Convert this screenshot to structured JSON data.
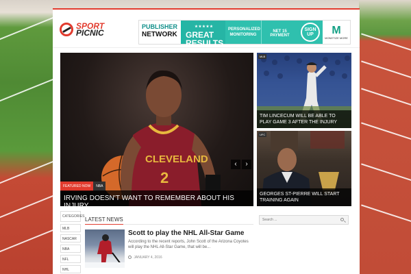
{
  "header": {
    "logo_line1": "SPORT",
    "logo_line2": "PICNIC"
  },
  "banner": {
    "publisher": "PUBLISHER",
    "network": "NETWORK",
    "great": "GREAT",
    "results": "RESULTS",
    "stars": "★★★★★",
    "personalized": "PERSONALIZED MONITORING",
    "payment": "NET 15 PAYMENT",
    "sign": "SIGN UP",
    "brand_mark": "M",
    "brand_name": "MONETIZE MORE"
  },
  "featured": {
    "tag_featured": "FEATURED NOW",
    "tag_league": "NBA",
    "title": "IRVING DOESN'T WANT TO REMEMBER ABOUT HIS INJURY",
    "jersey_text": "CLEVELAND",
    "jersey_number": "2",
    "prev_label": "‹",
    "next_label": "›"
  },
  "side_cards": [
    {
      "category": "MLB",
      "caption": "TIM LINCECUM WILL BE ABLE TO PLAY GAME 3 AFTER THE INJURY"
    },
    {
      "category": "UFC",
      "caption": "GEORGES ST-PIERRE WILL START TRAINING AGAIN"
    }
  ],
  "categories": {
    "title": "CATEGORIES",
    "items": [
      "MLB",
      "NASCAR",
      "NBA",
      "NFL",
      "NHL"
    ]
  },
  "latest": {
    "heading": "LATEST NEWS",
    "article": {
      "title": "Scott to play the NHL All-Star Game",
      "excerpt": "According to the recent reports, John Scott of the Arizona Coyotes will play the NHL All-Star Game, that will be...",
      "date": "JANUARY 4, 2016"
    }
  },
  "search": {
    "placeholder": "Search ..."
  },
  "colors": {
    "accent": "#e23b2e",
    "teal": "#26b5a5"
  }
}
